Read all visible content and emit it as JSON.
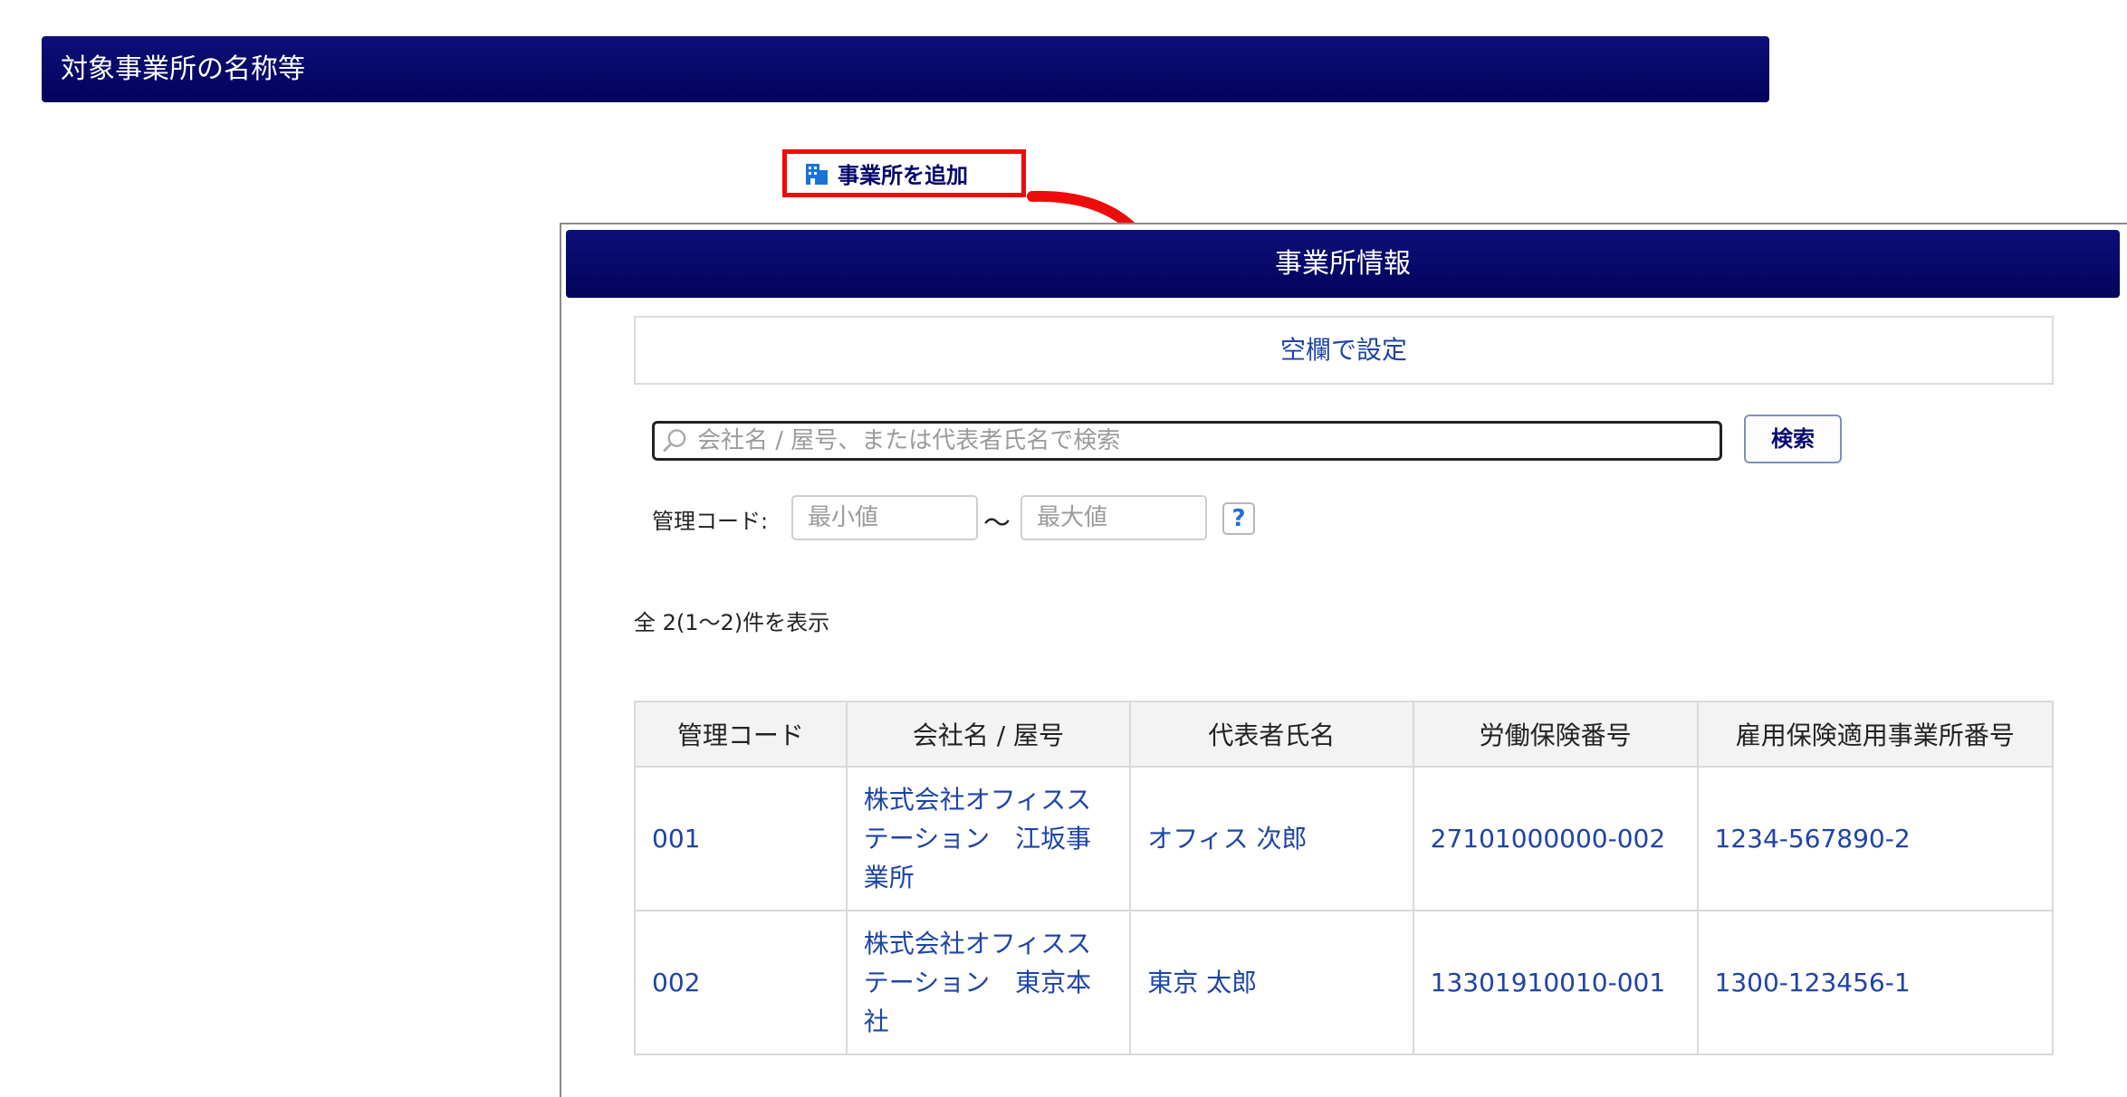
{
  "section": {
    "title": "対象事業所の名称等"
  },
  "add_office": {
    "label": "事業所を追加",
    "icon": "building-icon"
  },
  "dialog": {
    "title": "事業所情報",
    "blank_setting": "空欄で設定",
    "search": {
      "placeholder": "会社名 / 屋号、または代表者氏名で検索",
      "button": "検索"
    },
    "code_filter": {
      "label": "管理コード:",
      "min_placeholder": "最小値",
      "separator": "〜",
      "max_placeholder": "最大値",
      "help": "?"
    },
    "result_count": "全 2(1〜2)件を表示",
    "table": {
      "headers": [
        "管理コード",
        "会社名 / 屋号",
        "代表者氏名",
        "労働保険番号",
        "雇用保険適用事業所番号"
      ],
      "rows": [
        [
          "001",
          "株式会社オフィスステーション　江坂事業所",
          "オフィス 次郎",
          "27101000000-002",
          "1234-567890-2"
        ],
        [
          "002",
          "株式会社オフィスステーション　東京本社",
          "東京 太郎",
          "13301910010-001",
          "1300-123456-1"
        ]
      ]
    }
  },
  "colors": {
    "header_navy": "#02035c",
    "link_blue": "#1e44a8",
    "highlight_red": "#ee0b0b"
  }
}
